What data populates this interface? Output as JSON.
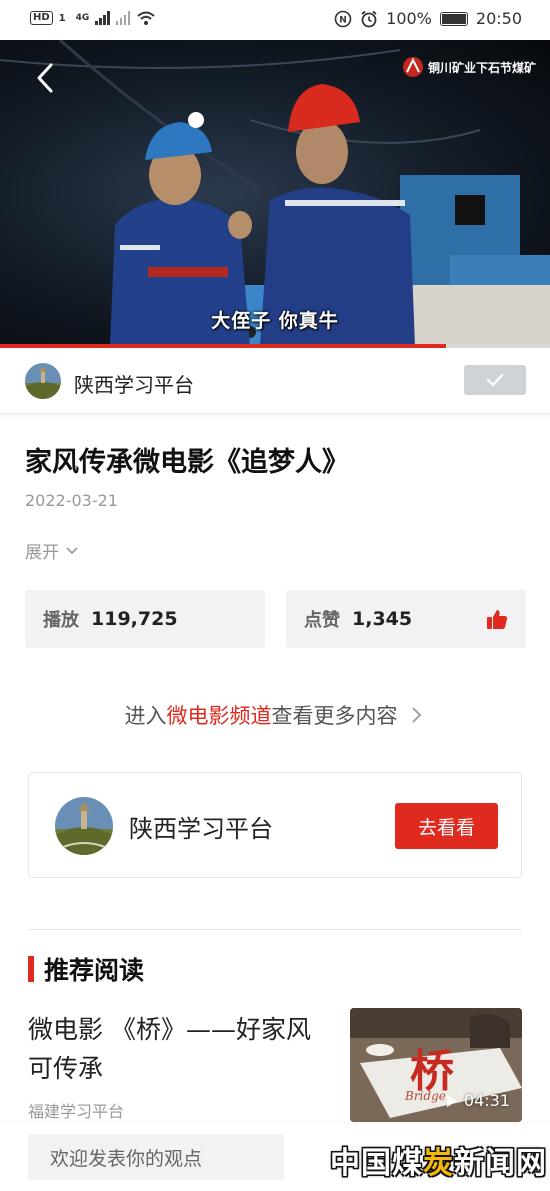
{
  "status_bar": {
    "network_badge": "HD",
    "sim_badge": "1",
    "network_type": "4G",
    "battery_percent": "100%",
    "time": "20:50"
  },
  "video": {
    "watermark": "铜川矿业下石节煤矿",
    "subtitle": "大侄子  你真牛",
    "progress": 0.81,
    "colors": {
      "progress": "#e0291f"
    }
  },
  "author": {
    "name": "陕西学习平台",
    "follow_state": "followed"
  },
  "article": {
    "title": "家风传承微电影《追梦人》",
    "date": "2022-03-21",
    "expand_label": "展开"
  },
  "stats": {
    "play_label": "播放",
    "play_count": "119,725",
    "like_label": "点赞",
    "like_count": "1,345"
  },
  "channel_link": {
    "prefix": "进入",
    "channel": "微电影频道",
    "suffix": "查看更多内容"
  },
  "publisher_card": {
    "name": "陕西学习平台",
    "button_label": "去看看"
  },
  "recommend": {
    "section_title": "推荐阅读",
    "items": [
      {
        "title": "微电影 《桥》——好家风可传承",
        "source": "福建学习平台",
        "thumb_text": "桥",
        "thumb_subtext": "Bridge",
        "duration": "04:31"
      }
    ]
  },
  "bottom_bar": {
    "comment_placeholder": "欢迎发表你的观点",
    "site_watermark_a": "中国煤",
    "site_watermark_b": "炭",
    "site_watermark_c": "新闻网"
  }
}
